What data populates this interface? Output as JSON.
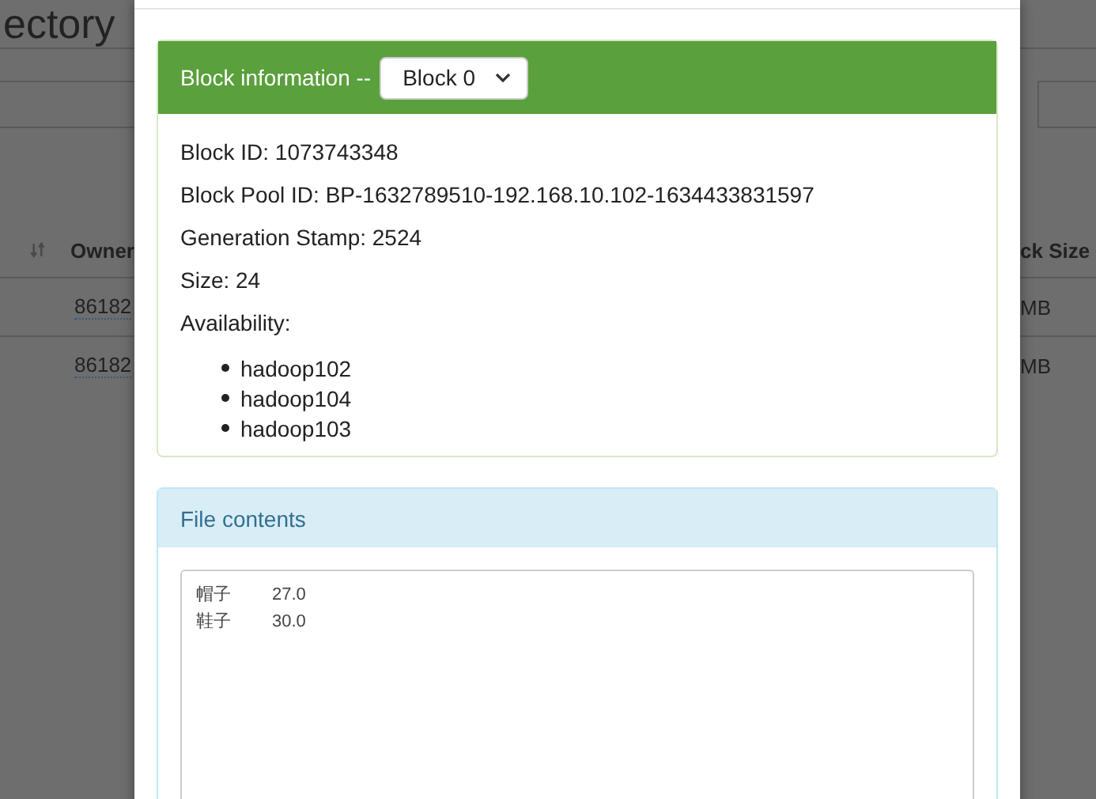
{
  "page_heading": "ectory",
  "table": {
    "columns": [
      "Owner",
      "ck Size"
    ],
    "rows": [
      {
        "owner": "86182",
        "block_size": "MB"
      },
      {
        "owner": "86182",
        "block_size": "MB"
      }
    ]
  },
  "modal": {
    "block_panel": {
      "title": "Block information --",
      "select_value": "Block 0",
      "fields": [
        "Block ID: 1073743348",
        "Block Pool ID: BP-1632789510-192.168.10.102-1634433831597",
        "Generation Stamp: 2524",
        "Size: 24",
        "Availability:"
      ],
      "hosts": [
        "hadoop102",
        "hadoop104",
        "hadoop103"
      ]
    },
    "contents_panel": {
      "title": "File contents",
      "lines": [
        {
          "name": "帽子",
          "value": "27.0"
        },
        {
          "name": "鞋子",
          "value": "30.0"
        }
      ]
    }
  }
}
